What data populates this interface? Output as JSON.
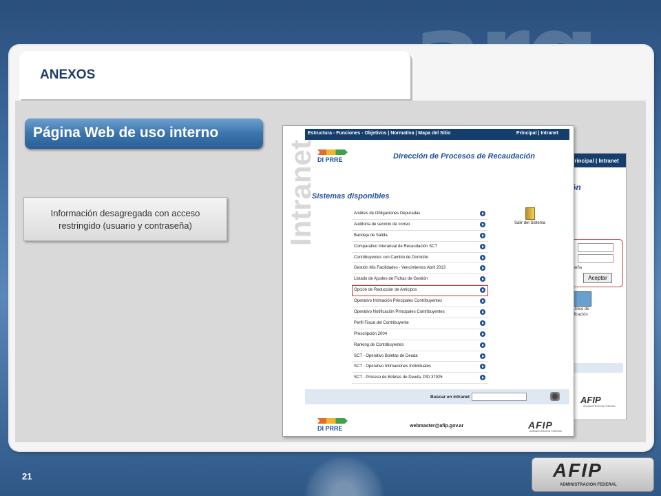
{
  "slide": {
    "section_title": "ANEXOS",
    "headline": "Página Web de uso interno",
    "info_text": "Información desagregada con acceso restringido (usuario y contraseña)",
    "page_number": "21",
    "bg_text": "arg"
  },
  "intranet_page": {
    "watermark": "Intranet",
    "nav_left": "Estructura - Funciones - Objetivos | Normativa | Mapa del Sitio",
    "nav_right": "Principal | Intranet",
    "logo_text": "DI PRRE",
    "title": "Dirección de Procesos de Recaudación",
    "systems_title": "Sistemas disponibles",
    "systems": [
      "Análisis de Obligaciones Depuradas",
      "Auditoría de servicio de correo",
      "Bandeja de Salida",
      "Comparativo Interanual de Recaudación SCT",
      "Contribuyentes con Cambio de Domicilio",
      "Gestión Mis Facilidades - Vencimientos Abril 2013",
      "Listado de Ajustes de Fichas de Gestión",
      "Opción de Reducción de Anticipos",
      "Operativo Intimación Principales Contribuyentes",
      "Operativo Notificación Principales Contribuyentes",
      "Perfil Fiscal del Contribuyente",
      "Prescripción 2004",
      "Ranking de Contribuyentes",
      "SCT - Operativo Boletas de Deuda",
      "SCT - Operativo Intimaciones Individuales",
      "SCT - Proceso de Boletas de Deuda. PID 37925"
    ],
    "highlighted_index": 7,
    "exit_label": "Salir del Sistema",
    "search_label": "Buscar en intranet",
    "email": "webmaster@afip.gov.ar",
    "afip": "AFIP",
    "afip_sub": "ADMINISTRACION FEDERAL"
  },
  "back_page": {
    "nav_right": "Principal | Intranet",
    "partial_title": "ón",
    "field_label": "traseña",
    "accept": "Aceptar",
    "text_line1": "a Único de",
    "text_line2": "ntificación",
    "afip": "AFIP",
    "afip_sub": "ADMINISTRACION FEDERAL"
  },
  "footer": {
    "logo": "AFIP",
    "logo_sub": "ADMINISTRACION FEDERAL"
  }
}
